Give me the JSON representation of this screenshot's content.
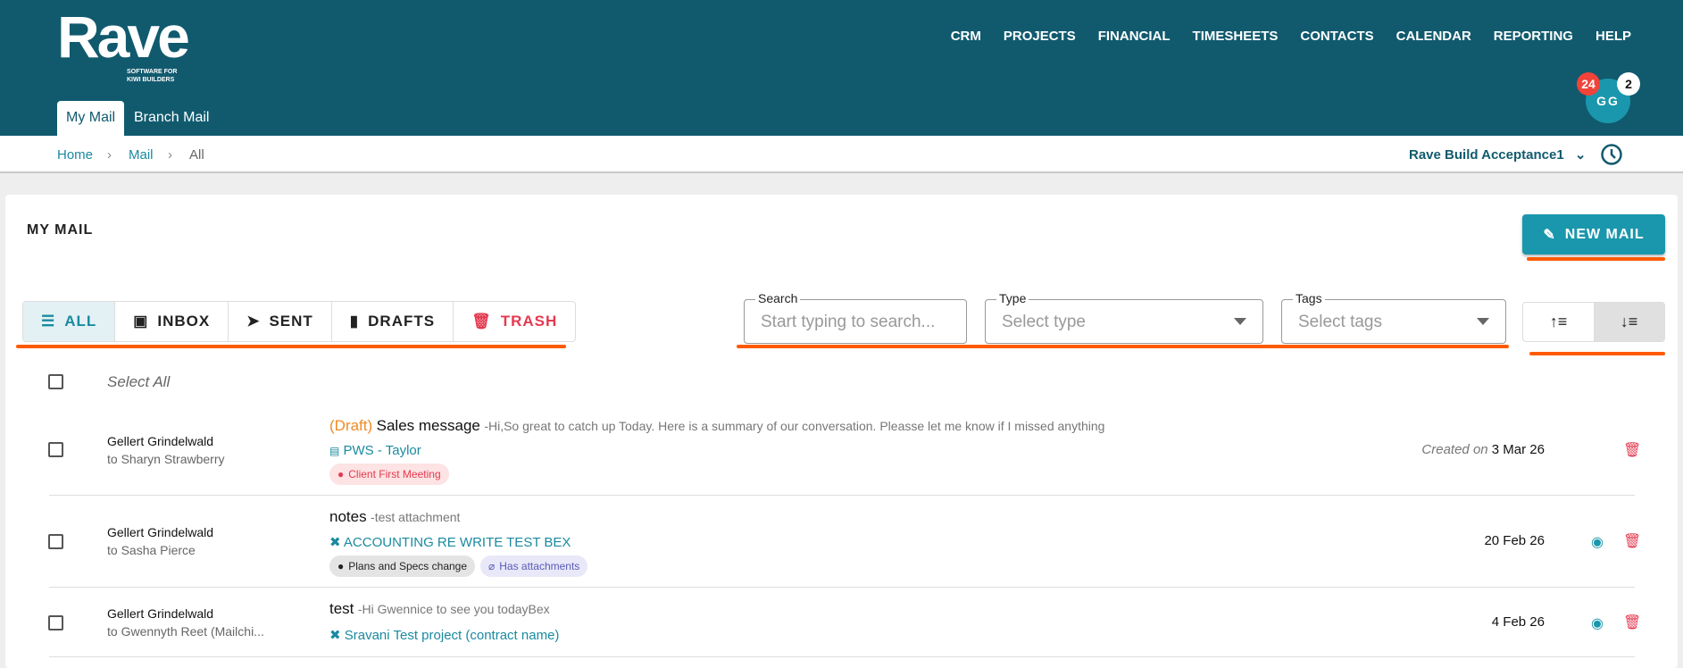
{
  "header": {
    "logo_text": "Rave",
    "logo_tagline_1": "SOFTWARE FOR",
    "logo_tagline_2": "KIWI BUILDERS",
    "nav": [
      "CRM",
      "PROJECTS",
      "FINANCIAL",
      "TIMESHEETS",
      "CONTACTS",
      "CALENDAR",
      "REPORTING",
      "HELP"
    ],
    "tabs": [
      "My Mail",
      "Branch Mail"
    ],
    "avatar": "GG",
    "badge_red": "24",
    "badge_white": "2"
  },
  "breadcrumb": {
    "home": "Home",
    "mail": "Mail",
    "current": "All",
    "sep": "›"
  },
  "company": {
    "name": "Rave Build Acceptance1"
  },
  "page": {
    "title": "MY MAIL",
    "new_mail": "NEW MAIL"
  },
  "filters": {
    "tabs": [
      "ALL",
      "INBOX",
      "SENT",
      "DRAFTS",
      "TRASH"
    ],
    "search_label": "Search",
    "search_placeholder": "Start typing to search...",
    "type_label": "Type",
    "type_placeholder": "Select type",
    "tags_label": "Tags",
    "tags_placeholder": "Select tags"
  },
  "select_all": "Select All",
  "colors": {
    "header": "#115a6e",
    "accent": "#1a97ac",
    "danger": "#e53950",
    "draft": "#f08a24"
  },
  "mails": [
    {
      "sender": "Gellert Grindelwald",
      "to": "to Sharyn Strawberry",
      "draft": "(Draft)",
      "subject": "Sales message",
      "preview": "-Hi,So great to catch up Today. Here is a summary of our conversation. Pleasse let me know if I missed anything",
      "project": "PWS - Taylor",
      "tags": [
        "Client First Meeting"
      ],
      "created_label": "Created on",
      "date": "3 Mar 26"
    },
    {
      "sender": "Gellert Grindelwald",
      "to": "to Sasha Pierce",
      "subject": "notes",
      "preview": "-test attachment",
      "project": "ACCOUNTING RE WRITE TEST BEX",
      "tags": [
        "Plans and Specs change",
        "Has attachments"
      ],
      "date": "20 Feb 26"
    },
    {
      "sender": "Gellert Grindelwald",
      "to": "to Gwennyth Reet (Mailchi...",
      "subject": "test",
      "preview": "-Hi Gwennice to see you todayBex",
      "project": "Sravani Test project (contract name)",
      "date": "4 Feb 26"
    }
  ]
}
